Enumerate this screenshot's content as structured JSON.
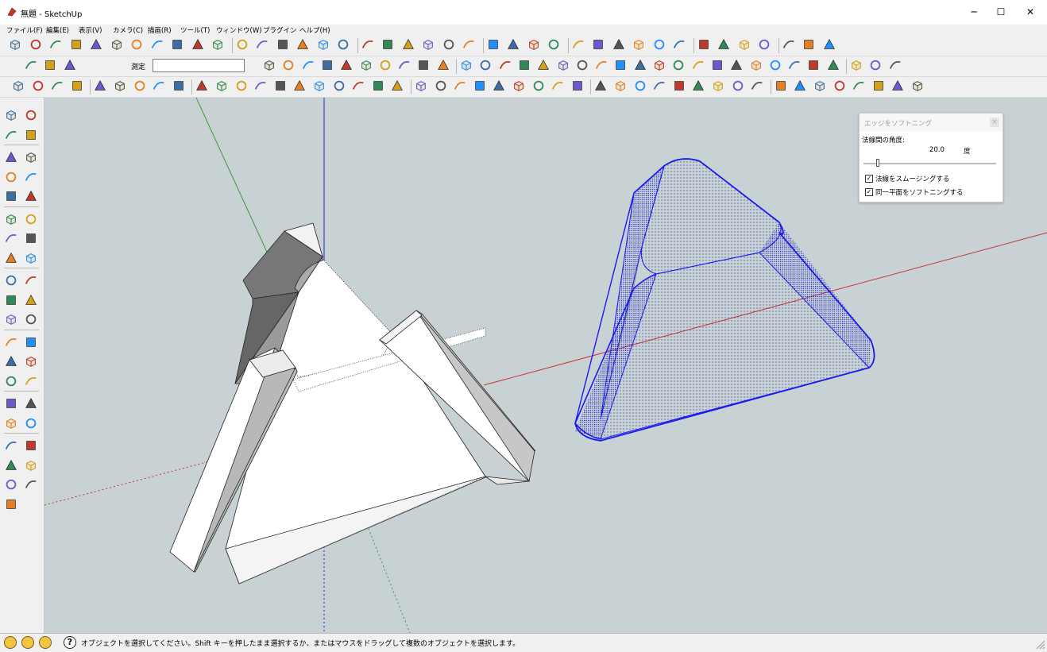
{
  "window": {
    "title": "無題 - SketchUp",
    "minimize_glyph": "─",
    "maximize_glyph": "☐",
    "close_glyph": "✕"
  },
  "menu": {
    "items": [
      {
        "label": "ファイル(F)"
      },
      {
        "label": "編集(E)"
      },
      {
        "label": "表示(V)"
      },
      {
        "label": "カメラ(C)"
      },
      {
        "label": "描画(R)"
      },
      {
        "label": "ツール(T)"
      },
      {
        "label": "ウィンドウ(W)"
      },
      {
        "label": "プラグイン"
      },
      {
        "label": "ヘルプ(H)"
      }
    ]
  },
  "measurements": {
    "label": "測定",
    "value": ""
  },
  "soften_dialog": {
    "title": "エッジをソフトニング",
    "close_glyph": "×",
    "angle_label": "法線間の角度:",
    "angle_value": "20.0",
    "angle_unit": "度",
    "angle_fraction": 0.11,
    "smooth_normals": {
      "label": "法線をスムージングする",
      "checked": true
    },
    "soften_coplanar": {
      "label": "同一平面をソフトニングする",
      "checked": true
    },
    "check_glyph": "✓"
  },
  "status": {
    "message": "オブジェクトを選択してください。Shift キーを押したまま選択するか、またはマウスをドラッグして複数のオブジェクトを選択します。",
    "help_glyph": "?"
  },
  "colors": {
    "selection": "#0000ee",
    "axis_red": "#c83232",
    "axis_green": "#3a9a3a",
    "axis_blue": "#2020c0",
    "background": "#c8d2d4",
    "title_accent": "#c0392b"
  },
  "icons": {
    "toolbar1": [
      "new-file-icon",
      "open-icon",
      "save-icon",
      "cut-icon",
      "copy-icon",
      "paste-icon",
      "erase-icon",
      "undo-icon",
      "redo-icon",
      "print-icon",
      "model-info-icon",
      "iso-view-icon",
      "top-view-icon",
      "front-view-icon",
      "right-view-icon",
      "back-view-icon",
      "left-view-icon",
      "xray-icon",
      "back-edges-icon",
      "wireframe-icon",
      "hidden-line-icon",
      "shaded-icon",
      "textured-icon",
      "monochrome-icon",
      "color-icon",
      "select-arrow-icon",
      "section-icon",
      "mirror-icon",
      "paint-icon",
      "push-icon",
      "move-up-icon",
      "move-down-icon",
      "scale-icon",
      "flip-icon",
      "rotate-cw-icon",
      "rotate-ccw-icon",
      "page-icon",
      "helmet-icon",
      "lock-icon",
      "shape-icon"
    ],
    "toolbar2": [
      "tool-orbit-icon",
      "cube-red-icon",
      "cube-hatch-icon",
      "surface-1-icon",
      "surface-2-icon",
      "surface-3-icon",
      "surface-4-icon",
      "surface-5-icon",
      "surface-6-icon",
      "surface-7-icon",
      "surface-8-icon",
      "surface-9-icon",
      "surface-10-icon",
      "curve-1-icon",
      "curve-2-icon",
      "curve-3-icon",
      "curve-4-icon",
      "curve-5-icon",
      "curve-6-icon",
      "curve-7-icon",
      "curve-8-icon",
      "curve-9-icon",
      "curve-10-icon",
      "curve-11-icon",
      "curve-12-icon",
      "curve-13-icon",
      "curve-14-icon",
      "curve-15-icon",
      "curve-16-icon",
      "curve-17-icon",
      "curve-18-icon",
      "curve-19-icon",
      "curve-20-icon",
      "solid-1-icon",
      "solid-2-icon",
      "solid-3-icon"
    ],
    "toolbar3": [
      "play-icon",
      "rewind-icon",
      "ui-icon",
      "box-icon",
      "record-icon",
      "camera-icon",
      "speaker-icon",
      "skip-icon",
      "back-icon",
      "spin-1-icon",
      "pencil-1-icon",
      "spin-2-icon",
      "pencil-2-icon",
      "spin-3-icon",
      "drop-icon",
      "ellipse-icon",
      "shape-green-icon",
      "tube-icon",
      "wand-icon",
      "cross-icon",
      "cube-1-icon",
      "sphere-1-icon",
      "cylinder-1-icon",
      "cone-1-icon",
      "cylinder-2-icon",
      "plane-1-icon",
      "torus-1-icon",
      "tube-1-icon",
      "figure-1-icon",
      "arrow-red-1-icon",
      "arrow-red-2-icon",
      "arrow-red-3-icon",
      "arrow-green-1-icon",
      "arrow-green-2-icon",
      "arrow-green-3-icon",
      "arrow-blue-1-icon",
      "arrow-blue-2-icon",
      "arrow-blue-3-icon",
      "panel-1-icon",
      "panel-2-icon",
      "panel-3-icon",
      "panel-4-icon",
      "dot-1-icon",
      "dot-2-icon",
      "dot-3-icon",
      "dot-4-icon"
    ],
    "left": [
      "select-icon",
      "component-icon",
      "paint-bucket-icon",
      "eraser-icon",
      "rectangle-icon",
      "pencil-icon",
      "circle-icon",
      "arc-icon",
      "polygon-icon",
      "freehand-icon",
      "move-icon",
      "push-pull-icon",
      "rotate-icon",
      "follow-me-icon",
      "scale-icon",
      "offset-icon",
      "tape-measure-icon",
      "dimension-icon",
      "protractor-icon",
      "text-icon",
      "axes-icon",
      "3d-text-icon",
      "orbit-icon",
      "pan-icon",
      "zoom-icon",
      "zoom-window-icon",
      "zoom-extents-icon",
      "previous-view-icon",
      "position-camera-icon",
      "look-around-icon",
      "walk-icon",
      "section-plane-icon",
      "sandbox-1-icon",
      "sandbox-2-icon",
      "sandbox-3-icon",
      "sandbox-4-icon",
      "sandbox-5-icon",
      "sandbox-6-icon",
      "sandbox-7-icon"
    ],
    "status": [
      "geo-location-icon",
      "credits-icon",
      "user-icon",
      "help-icon"
    ]
  }
}
